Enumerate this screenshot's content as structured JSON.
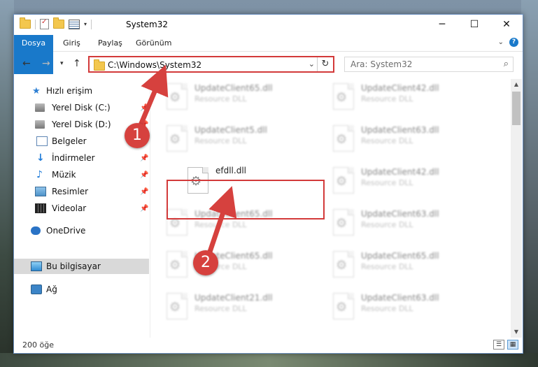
{
  "window": {
    "title": "System32"
  },
  "ribbon": {
    "tabs": [
      "Dosya",
      "Giriş",
      "Paylaş",
      "Görünüm"
    ],
    "accent": "#1979ca",
    "help": "?"
  },
  "address": {
    "path": "C:\\Windows\\System32"
  },
  "search": {
    "placeholder": "Ara: System32"
  },
  "nav": {
    "items": [
      {
        "label": "Hızlı erişim",
        "icon": "star-icon"
      },
      {
        "label": "Yerel Disk (C:)",
        "icon": "disk-icon",
        "pinned": true
      },
      {
        "label": "Yerel Disk (D:)",
        "icon": "disk-icon",
        "pinned": true
      },
      {
        "label": "Belgeler",
        "icon": "documents-icon",
        "pinned": true
      },
      {
        "label": "İndirmeler",
        "icon": "downloads-icon",
        "pinned": true
      },
      {
        "label": "Müzik",
        "icon": "music-icon",
        "pinned": true
      },
      {
        "label": "Resimler",
        "icon": "pictures-icon",
        "pinned": true
      },
      {
        "label": "Videolar",
        "icon": "videos-icon",
        "pinned": true
      },
      {
        "label": "OneDrive",
        "icon": "onedrive-icon"
      },
      {
        "label": "Bu bilgisayar",
        "icon": "this-pc-icon",
        "selected": true
      },
      {
        "label": "Ağ",
        "icon": "network-icon"
      }
    ]
  },
  "files": [
    {
      "name": "UpdateClient65.dll",
      "type": "Resource DLL"
    },
    {
      "name": "UpdateClient42.dll",
      "type": "Resource DLL"
    },
    {
      "name": "UpdateClient5.dll",
      "type": "Resource DLL"
    },
    {
      "name": "UpdateClient63.dll",
      "type": "Resource DLL"
    },
    {
      "name": "efdll.dll",
      "type": ""
    },
    {
      "name": "UpdateClient42.dll",
      "type": "Resource DLL"
    },
    {
      "name": "UpdateClient65.dll",
      "type": "Resource DLL"
    },
    {
      "name": "UpdateClient63.dll",
      "type": "Resource DLL"
    },
    {
      "name": "UpdateClient65.dll",
      "type": "Resource DLL"
    },
    {
      "name": "UpdateClient65.dll",
      "type": "Resource DLL"
    },
    {
      "name": "UpdateClient21.dll",
      "type": "Resource DLL"
    },
    {
      "name": "UpdateClient63.dll",
      "type": "Resource DLL"
    }
  ],
  "status": {
    "count": "200 öğe"
  },
  "callouts": {
    "one": "1",
    "two": "2",
    "color": "#d6413e"
  }
}
